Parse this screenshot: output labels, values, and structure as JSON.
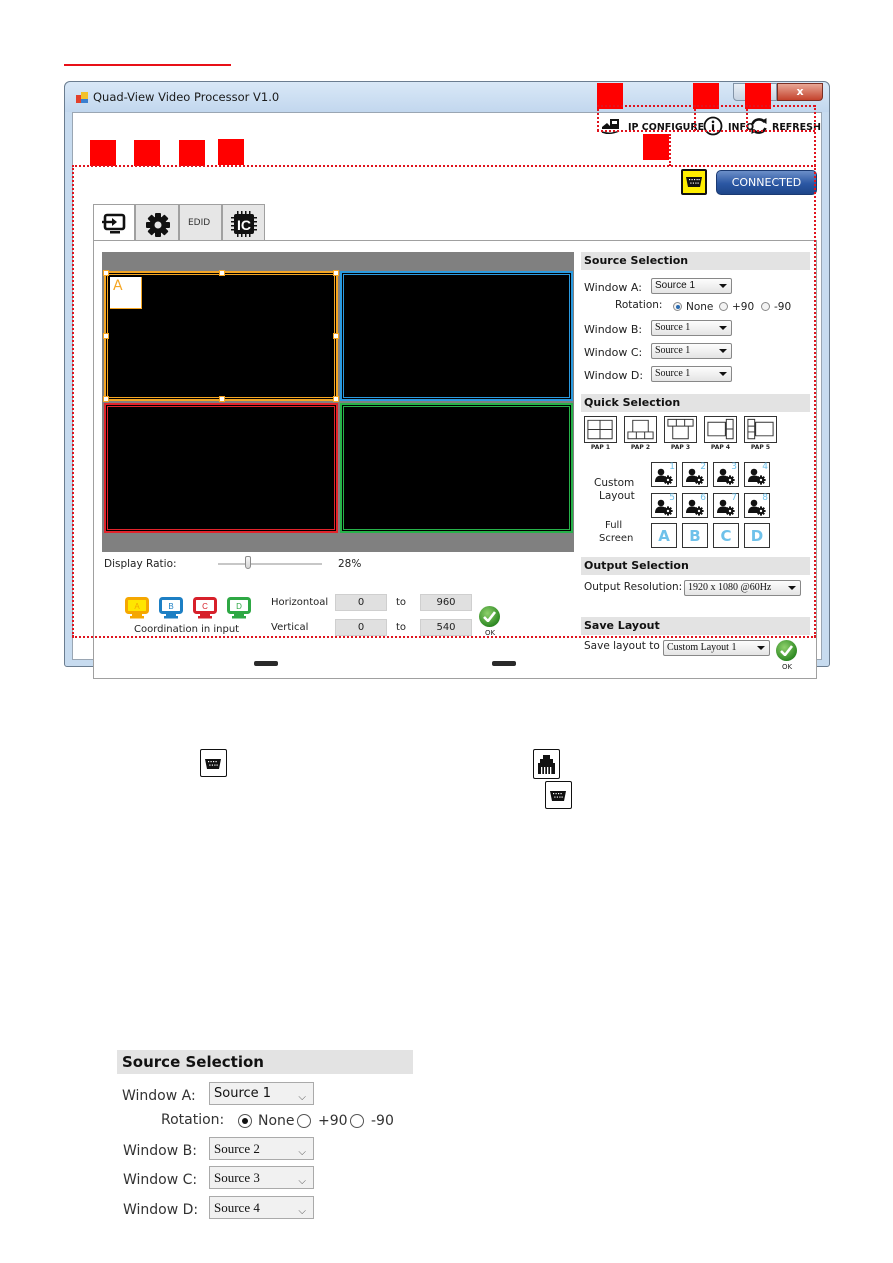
{
  "window": {
    "title": "Quad-View Video Processor V1.0",
    "close_label": "x"
  },
  "toolbar": {
    "ip_configure_label": "IP CONFIGURE",
    "info_label": "INFO",
    "refresh_label": "REFRESH",
    "connect_status_label": "CONNECTED",
    "connection_mode_icon": "serial-port-icon"
  },
  "tabs": [
    {
      "name": "input-source",
      "icon": "input-icon",
      "label": ""
    },
    {
      "name": "settings",
      "icon": "gear-icon",
      "label": ""
    },
    {
      "name": "edid",
      "icon": "",
      "label": "EDID"
    },
    {
      "name": "ic",
      "icon": "chip-icon",
      "label": "IC"
    }
  ],
  "preview": {
    "windows": [
      {
        "id": "A",
        "color": "#f5a623",
        "selected": true
      },
      {
        "id": "B",
        "color": "#2a9ae0",
        "selected": false
      },
      {
        "id": "C",
        "color": "#e2242c",
        "selected": false
      },
      {
        "id": "D",
        "color": "#27b24a",
        "selected": false
      }
    ],
    "selected_badge": "A"
  },
  "display_ratio": {
    "label": "Display Ratio:",
    "value_text": "28%",
    "value_fraction": 0.28
  },
  "coordination": {
    "caption": "Coordination in input",
    "monitors": [
      {
        "letter": "A",
        "color": "#f5a700",
        "fill": "#ffe600"
      },
      {
        "letter": "B",
        "color": "#1d7fc4",
        "fill": "#ffffff"
      },
      {
        "letter": "C",
        "color": "#d7202a",
        "fill": "#ffffff"
      },
      {
        "letter": "D",
        "color": "#2ea844",
        "fill": "#ffffff"
      }
    ],
    "horizontal_label": "Horizontoal",
    "vertical_label": "Vertical",
    "to_label": "to",
    "h_from": "0",
    "h_to": "960",
    "v_from": "0",
    "v_to": "540",
    "ok_label": "OK"
  },
  "source_selection": {
    "heading": "Source Selection",
    "window_a_label": "Window A:",
    "window_a_value": "Source 1",
    "rotation_label": "Rotation:",
    "rotation_options": [
      "None",
      "+90",
      "-90"
    ],
    "rotation_selected": "None",
    "window_b_label": "Window B:",
    "window_b_value": "Source 1",
    "window_c_label": "Window C:",
    "window_c_value": "Source 1",
    "window_d_label": "Window D:",
    "window_d_value": "Source 1"
  },
  "quick_selection": {
    "heading": "Quick Selection",
    "pap_presets": [
      "PAP 1",
      "PAP 2",
      "PAP 3",
      "PAP 4",
      "PAP 5"
    ],
    "custom_layout_label_1": "Custom",
    "custom_layout_label_2": "Layout",
    "custom_layouts": [
      "1",
      "2",
      "3",
      "4",
      "5",
      "6",
      "7",
      "8"
    ],
    "full_screen_label_1": "Full",
    "full_screen_label_2": "Screen",
    "full_screen_buttons": [
      "A",
      "B",
      "C",
      "D"
    ]
  },
  "output_selection": {
    "heading": "Output Selection",
    "resolution_label": "Output Resolution:",
    "resolution_value": "1920 x 1080 @60Hz"
  },
  "save_layout": {
    "heading": "Save Layout",
    "save_to_label": "Save layout to",
    "save_to_value": "Custom Layout 1",
    "ok_label": "OK"
  },
  "manual_icons": {
    "serial_icon": "serial-port-icon",
    "ethernet_icon": "ethernet-port-icon"
  },
  "zoomed_source_selection": {
    "heading": "Source Selection",
    "window_a_label": "Window A:",
    "window_a_value": "Source 1",
    "rotation_label": "Rotation:",
    "rotation_options": [
      "None",
      "+90",
      "-90"
    ],
    "rotation_selected": "None",
    "window_b_label": "Window B:",
    "window_b_value": "Source 2",
    "window_c_label": "Window C:",
    "window_c_value": "Source 3",
    "window_d_label": "Window D:",
    "window_d_value": "Source 4"
  }
}
